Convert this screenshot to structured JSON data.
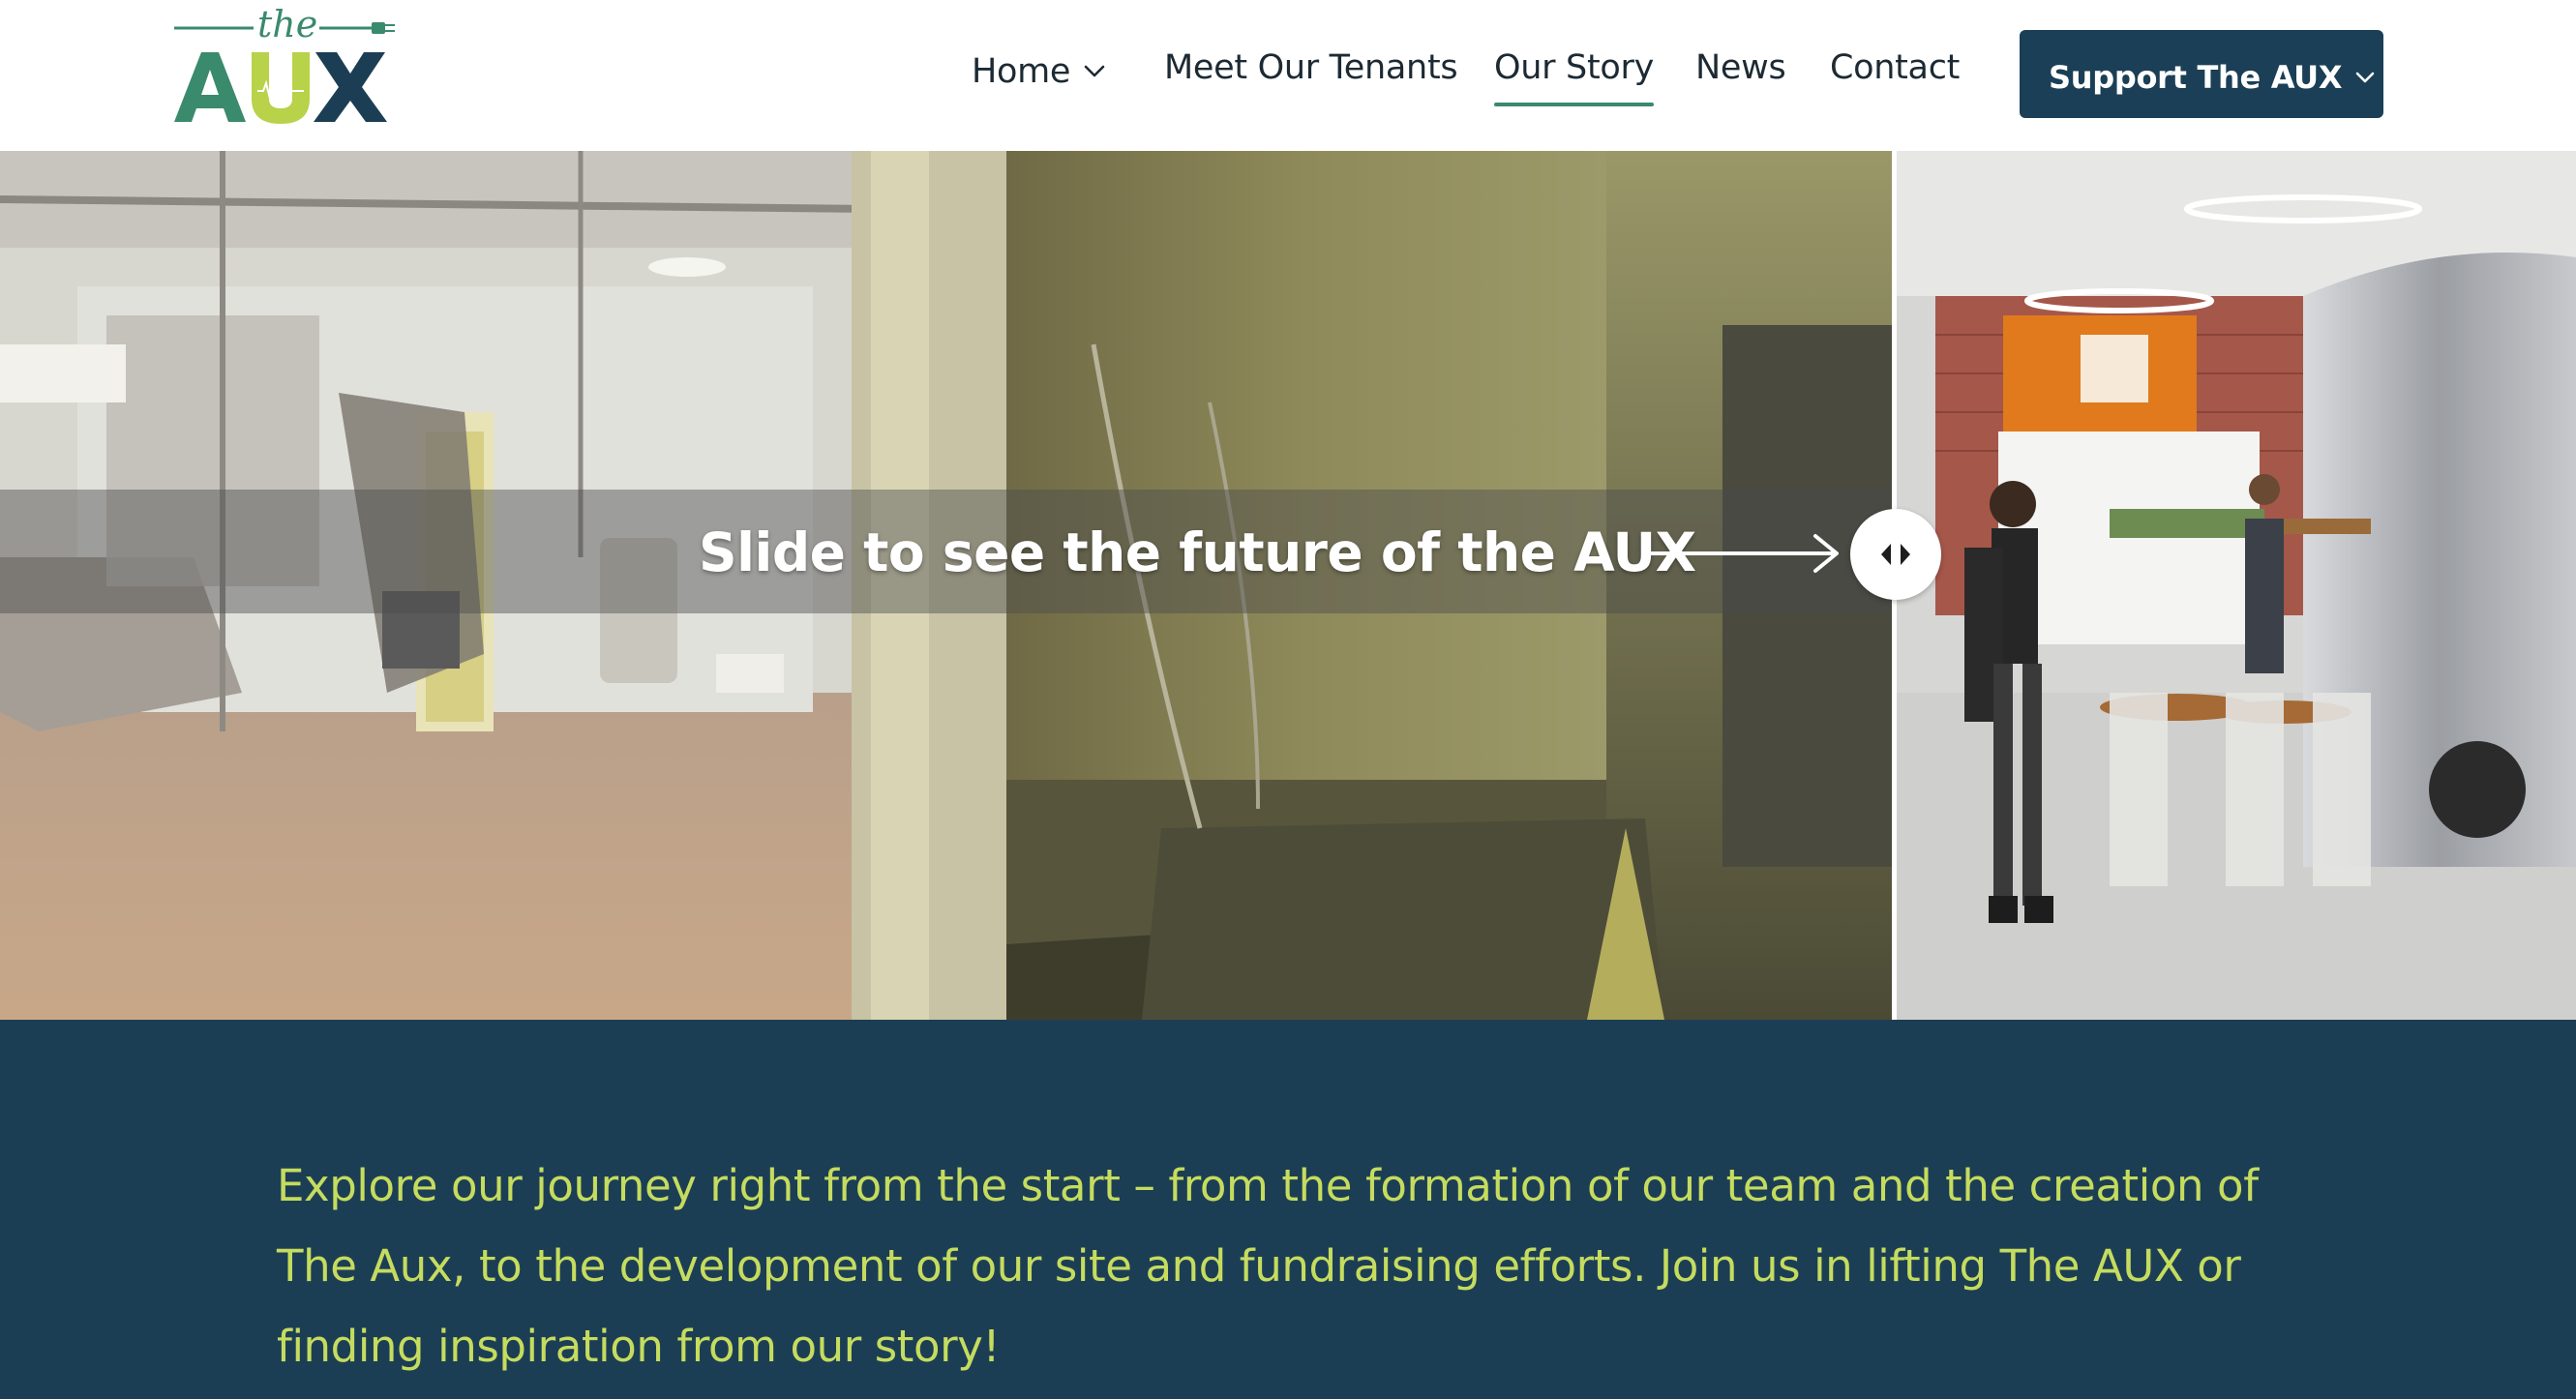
{
  "brand": {
    "logo_small": "the",
    "logo_large": "AUX",
    "colors": {
      "green": "#3a8a6d",
      "lime": "#b8d24a",
      "navy": "#1c3e55"
    }
  },
  "nav": {
    "items": [
      {
        "label": "Home",
        "has_dropdown": true,
        "active": false
      },
      {
        "label": "Meet Our Tenants",
        "has_dropdown": false,
        "active": false
      },
      {
        "label": "Our Story",
        "has_dropdown": false,
        "active": true
      },
      {
        "label": "News",
        "has_dropdown": false,
        "active": false
      },
      {
        "label": "Contact",
        "has_dropdown": false,
        "active": false
      }
    ],
    "cta_label": "Support The AUX"
  },
  "hero": {
    "caption": "Slide to see the future of the AUX",
    "slider_position": 0.735
  },
  "intro": {
    "text": "Explore our journey right from the start – from the formation of our team and the creation of The Aux, to the development of our site and fundraising efforts. Join us in lifting The AUX or finding inspiration from our story!"
  },
  "icons": [
    "chevron-down-icon",
    "arrow-right-icon",
    "slider-handle-icon"
  ]
}
